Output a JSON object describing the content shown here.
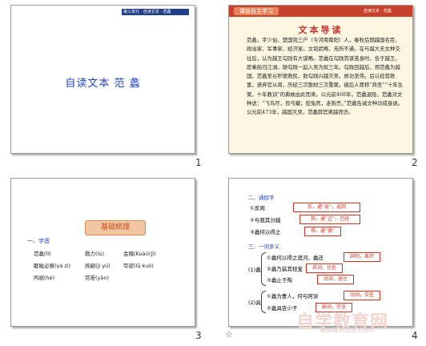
{
  "slides": [
    {
      "number": "1",
      "header_text": "第三单元 · 自读文本 · 范蠡",
      "title": "自读文本  范  蠡"
    },
    {
      "number": "2",
      "tag": "课前自主学习",
      "header_text": "自读文本 · 范蠡",
      "title": "文本导读",
      "body": "范蠡，字少伯，楚国宛三户（今河南南阳）人，春秋后期越国名臣、政治家、军事家、经济家。文韬武略，无所不通。在与越大夫文种交往后，认为越王勾践有大谋略。范蠡在勾践劳谋苦身时，告于越王，愿乘船归江湖。随勾践一起入吴为奴三年。勾践回越后，用范蠡为越国。范蠡至谷积德救民，助勾践兴越灭吴，居功至伟。后以经营致富，遂弃官从商，历经三次散财三次重聚，被后人尊称“商圣”“十年生聚，十年教训”的典故由此而来。公元前468年，范蠡退隐，范蠡对文种说：“飞鸟尽，良弓藏；狡兔死，走狗烹。”范蠡告诫文种功成身退。公元前473年，越国灭吴，范蠡辞官离越而去。"
    },
    {
      "number": "3",
      "banner": "基础梳理",
      "section": "一、字音",
      "vocab": [
        "范蠡(lǐ)",
        "戮力(lù)",
        "会稽(Kuài)(jī)",
        "睚眦必报(yá zì)",
        "觊觎(jì yú)",
        "夸欲(lǜ kuò)",
        "鸬鹚(hé)",
        "劳苦(yān)"
      ]
    },
    {
      "number": "4",
      "section1": "二、通假字",
      "items1": [
        {
          "label": "①反闻",
          "answer": "反，通“返”，返回"
        },
        {
          "label": "②与我其分越",
          "answer": "其，通“己”，已经"
        },
        {
          "label": "③蠡何以得之",
          "answer": "得，通“德”"
        }
      ],
      "section2": "三、一词多义",
      "group1": {
        "head": "(1)蠡",
        "items": [
          {
            "label": "①蠡何以得之渡河，蠡还",
            "answer": "辞别，离开"
          },
          {
            "label": "②蠡乃装其轻宝",
            "answer": "名词，住处"
          },
          {
            "label": "③蠡止于陶",
            "answer": "动词，居住"
          }
        ]
      },
      "group2": {
        "head": "(2)具",
        "items": [
          {
            "label": "①蠡为曹人，何与阿谀",
            "answer": "动词，交往"
          },
          {
            "label": "②蠡具告少子",
            "answer": "副词，完全"
          }
        ]
      }
    }
  ],
  "watermark": "自学教育网",
  "watermark_url": "www.ht88.com",
  "star_icon": "☆"
}
